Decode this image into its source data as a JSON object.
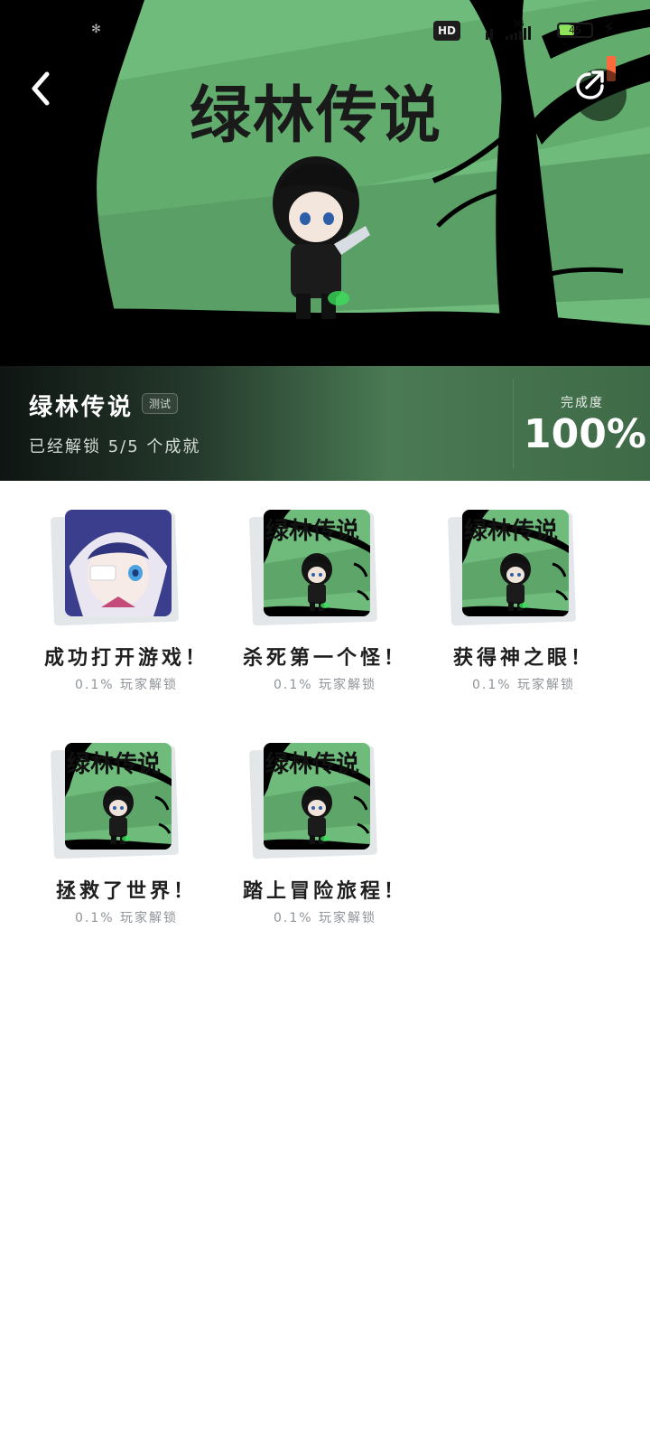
{
  "status_bar": {
    "network_badge": "HD",
    "network_type": "5G",
    "battery_level": "45",
    "battery_fraction": 0.45
  },
  "hero": {
    "title": "绿林传说",
    "back_icon": "chevron-left-icon",
    "share_icon": "share-icon"
  },
  "game": {
    "name": "绿林传说",
    "tag": "测试",
    "unlocked_text": "已经解锁 5/5 个成就",
    "completion_label": "完成度",
    "completion_value": "100%"
  },
  "achievements": [
    {
      "name": "成功打开游戏！",
      "rate": "0.1% 玩家解锁",
      "image": "anime-girl"
    },
    {
      "name": "杀死第一个怪！",
      "rate": "0.1% 玩家解锁",
      "image": "game-cover"
    },
    {
      "name": "获得神之眼！",
      "rate": "0.1% 玩家解锁",
      "image": "game-cover"
    },
    {
      "name": "拯救了世界！",
      "rate": "0.1% 玩家解锁",
      "image": "game-cover"
    },
    {
      "name": "踏上冒险旅程！",
      "rate": "0.1% 玩家解锁",
      "image": "game-cover"
    }
  ],
  "cover_text": "绿林传说"
}
